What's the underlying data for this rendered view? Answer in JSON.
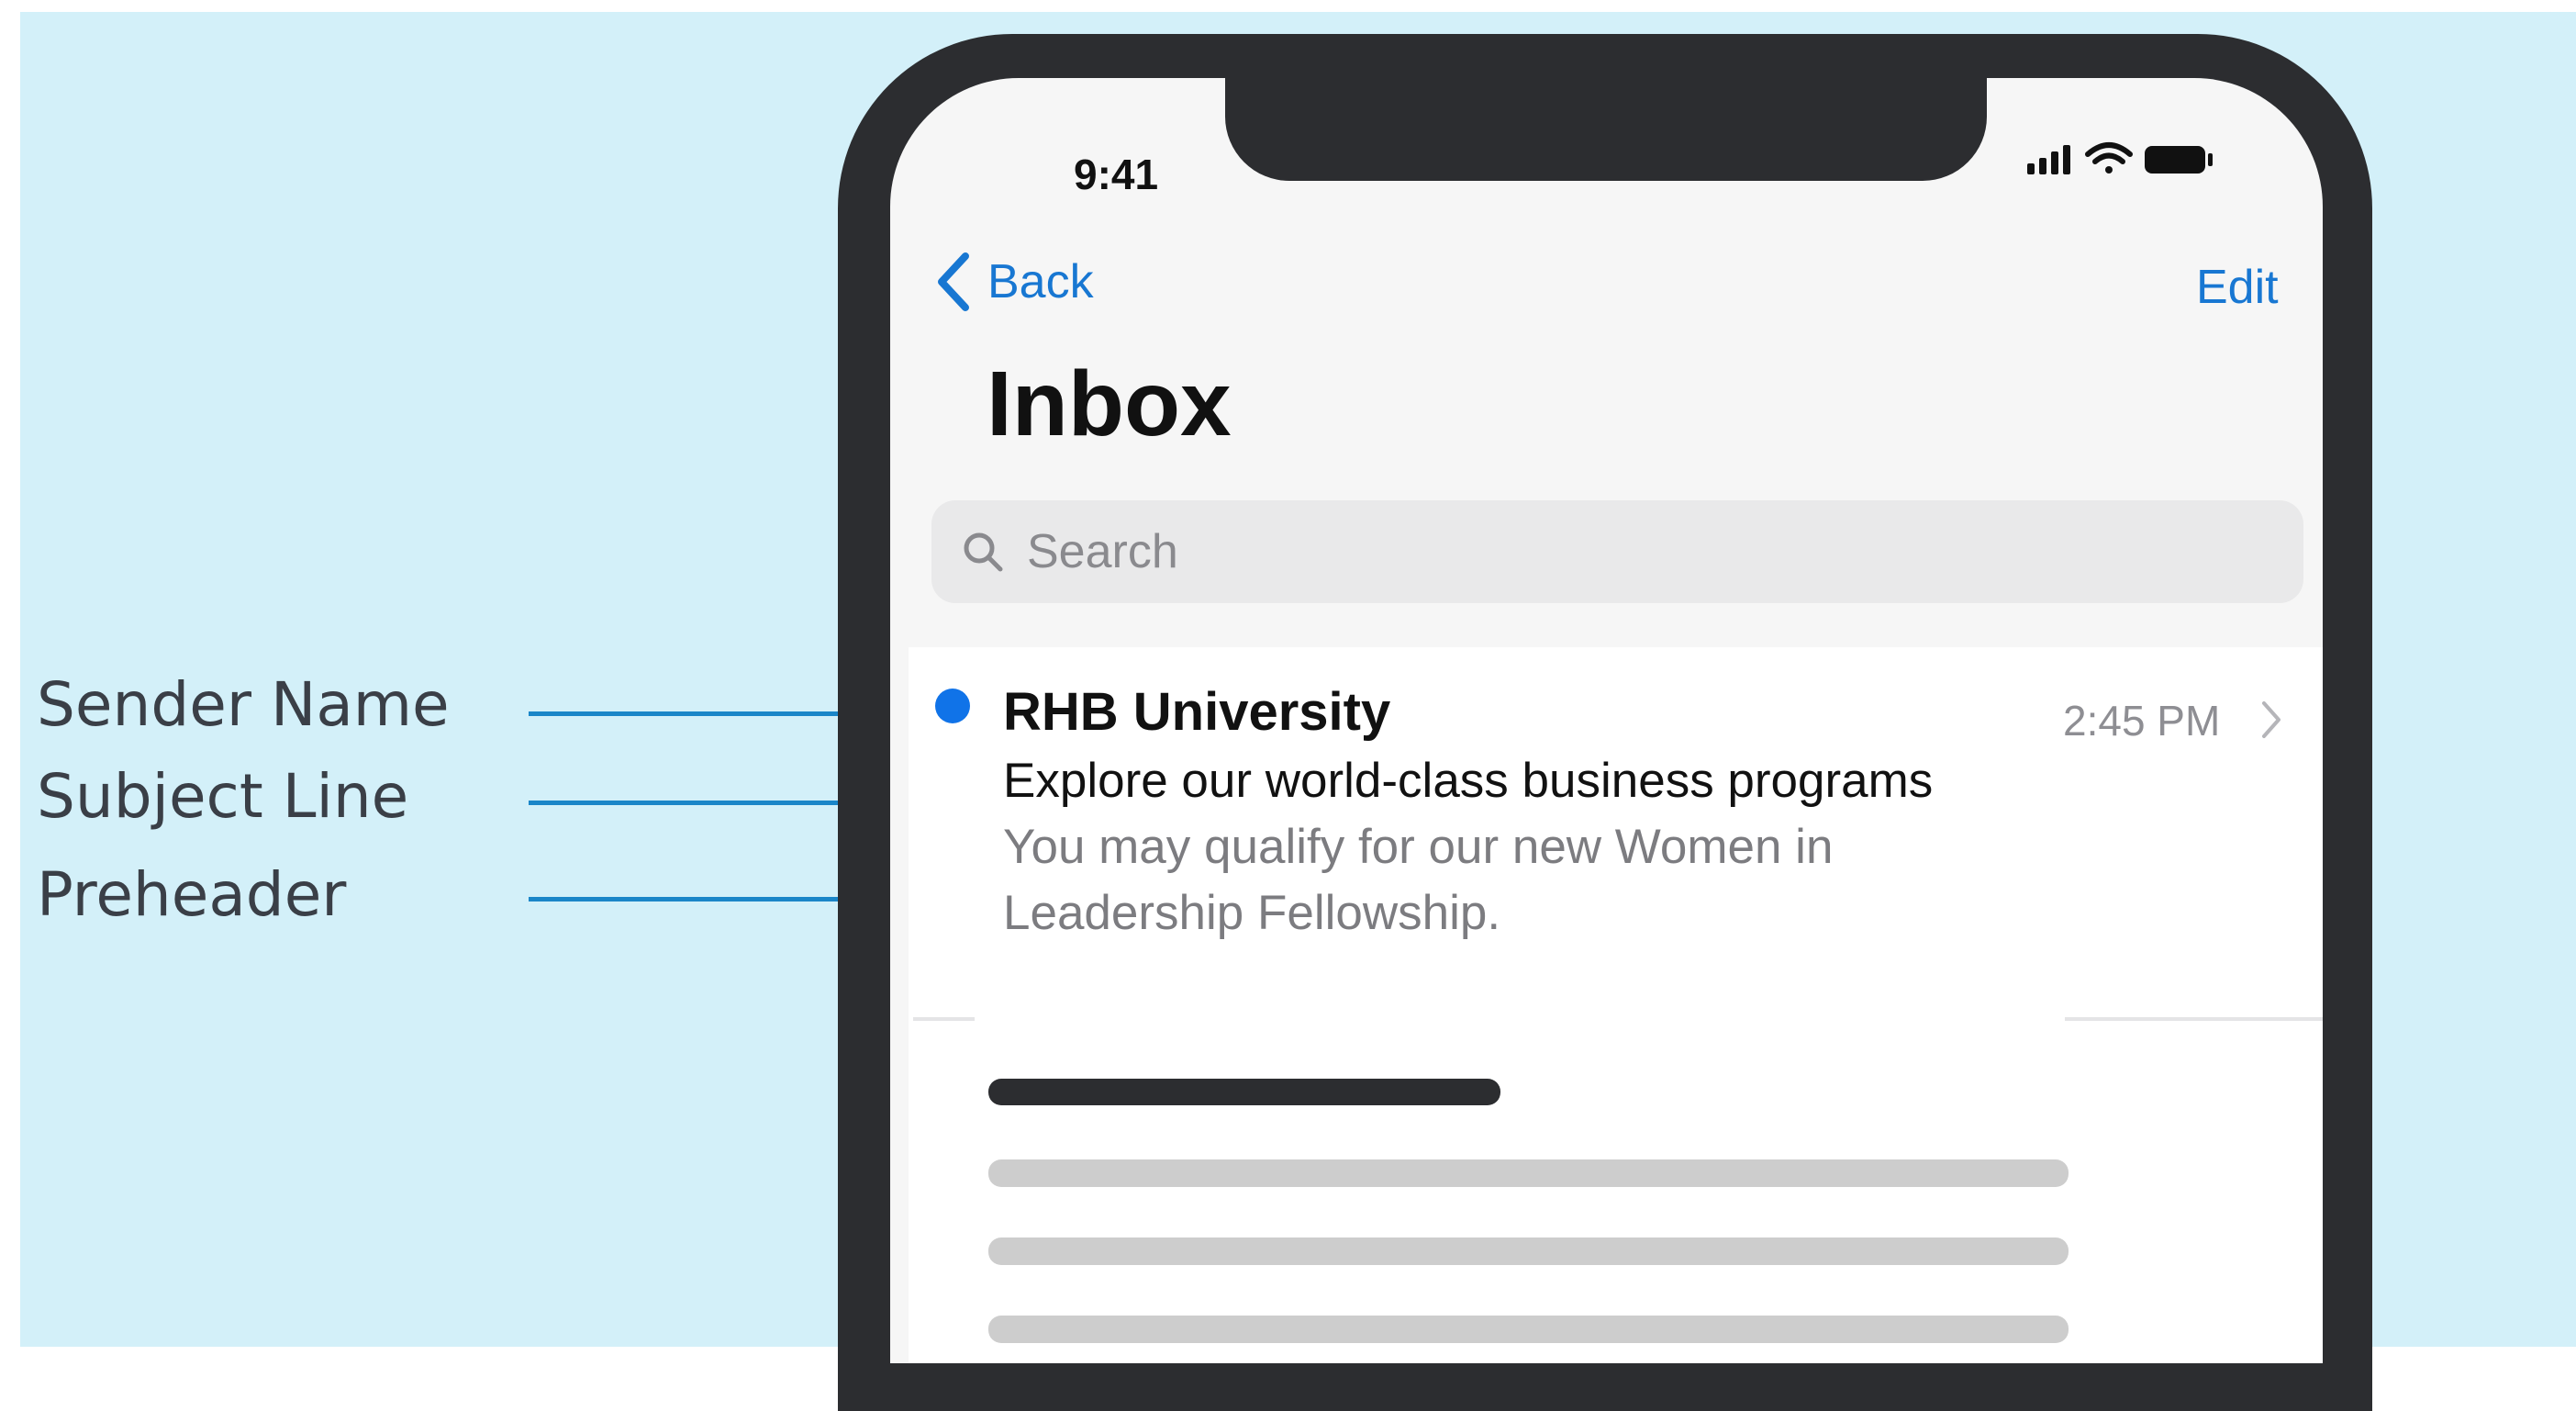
{
  "annotations": [
    {
      "label": "Sender Name"
    },
    {
      "label": "Subject Line"
    },
    {
      "label": "Preheader"
    }
  ],
  "status_bar": {
    "time": "9:41"
  },
  "nav": {
    "back_label": "Back",
    "edit_label": "Edit"
  },
  "page_title": "Inbox",
  "search": {
    "placeholder": "Search"
  },
  "message": {
    "sender": "RHB University",
    "time": "2:45 PM",
    "subject": "Explore our world-class business programs",
    "preheader": "You may qualify for our new Women in Leadership Fellowship.",
    "unread": true
  },
  "colors": {
    "background": "#d3f0f9",
    "accent": "#1877d2",
    "annotation_line": "#1a86c8",
    "unread_dot": "#1073e8",
    "phone_frame": "#2c2d30"
  },
  "icons": [
    "chevron-left-icon",
    "search-icon",
    "chevron-right-icon",
    "signal-icon",
    "wifi-icon",
    "battery-icon"
  ]
}
